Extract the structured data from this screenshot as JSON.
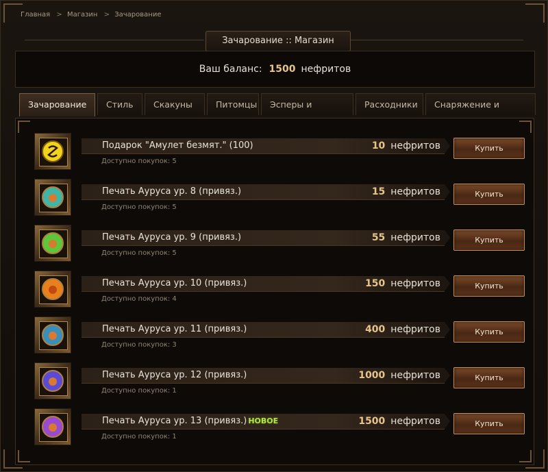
{
  "breadcrumb": [
    "Главная",
    "Магазин",
    "Зачарование"
  ],
  "breadcrumb_sep": ">",
  "title": "Зачарование :: Магазин",
  "balance": {
    "label": "Ваш баланс:",
    "amount": "1500",
    "currency": "нефритов"
  },
  "tabs": [
    "Зачарование",
    "Стиль",
    "Скакуны",
    "Питомцы",
    "Эсперы и полеты",
    "Расходники",
    "Снаряжение и прочее"
  ],
  "active_tab": "Зачарование",
  "items": [
    {
      "name": "Подарок \"Амулет безмят.\" (100)",
      "price": "10",
      "currency": "нефритов",
      "available": "Доступно покупок: 5",
      "buy": "Купить",
      "icon": "amulet-icon",
      "color": "#f2d21a",
      "new": ""
    },
    {
      "name": "Печать Ауруса ур. 8 (привяз.)",
      "price": "15",
      "currency": "нефритов",
      "available": "Доступно покупок: 5",
      "buy": "Купить",
      "icon": "seal-icon",
      "color": "#3fb5a8",
      "new": ""
    },
    {
      "name": "Печать Ауруса ур. 9 (привяз.)",
      "price": "55",
      "currency": "нефритов",
      "available": "Доступно покупок: 5",
      "buy": "Купить",
      "icon": "seal-icon",
      "color": "#5ec63a",
      "new": ""
    },
    {
      "name": "Печать Ауруса ур. 10 (привяз.)",
      "price": "150",
      "currency": "нефритов",
      "available": "Доступно покупок: 4",
      "buy": "Купить",
      "icon": "seal-icon",
      "color": "#e8801c",
      "new": ""
    },
    {
      "name": "Печать Ауруса ур. 11 (привяз.)",
      "price": "400",
      "currency": "нефритов",
      "available": "Доступно покупок: 3",
      "buy": "Купить",
      "icon": "seal-icon",
      "color": "#3a8fb8",
      "new": ""
    },
    {
      "name": "Печать Ауруса ур. 12 (привяз.)",
      "price": "1000",
      "currency": "нефритов",
      "available": "Доступно покупок: 1",
      "buy": "Купить",
      "icon": "seal-icon",
      "color": "#5a4ad6",
      "new": ""
    },
    {
      "name": "Печать Ауруса ур. 13 (привяз.)",
      "price": "1500",
      "currency": "нефритов",
      "available": "Доступно покупок: 1",
      "buy": "Купить",
      "icon": "seal-icon",
      "color": "#9a4ad0",
      "new": "НОВОЕ"
    }
  ]
}
